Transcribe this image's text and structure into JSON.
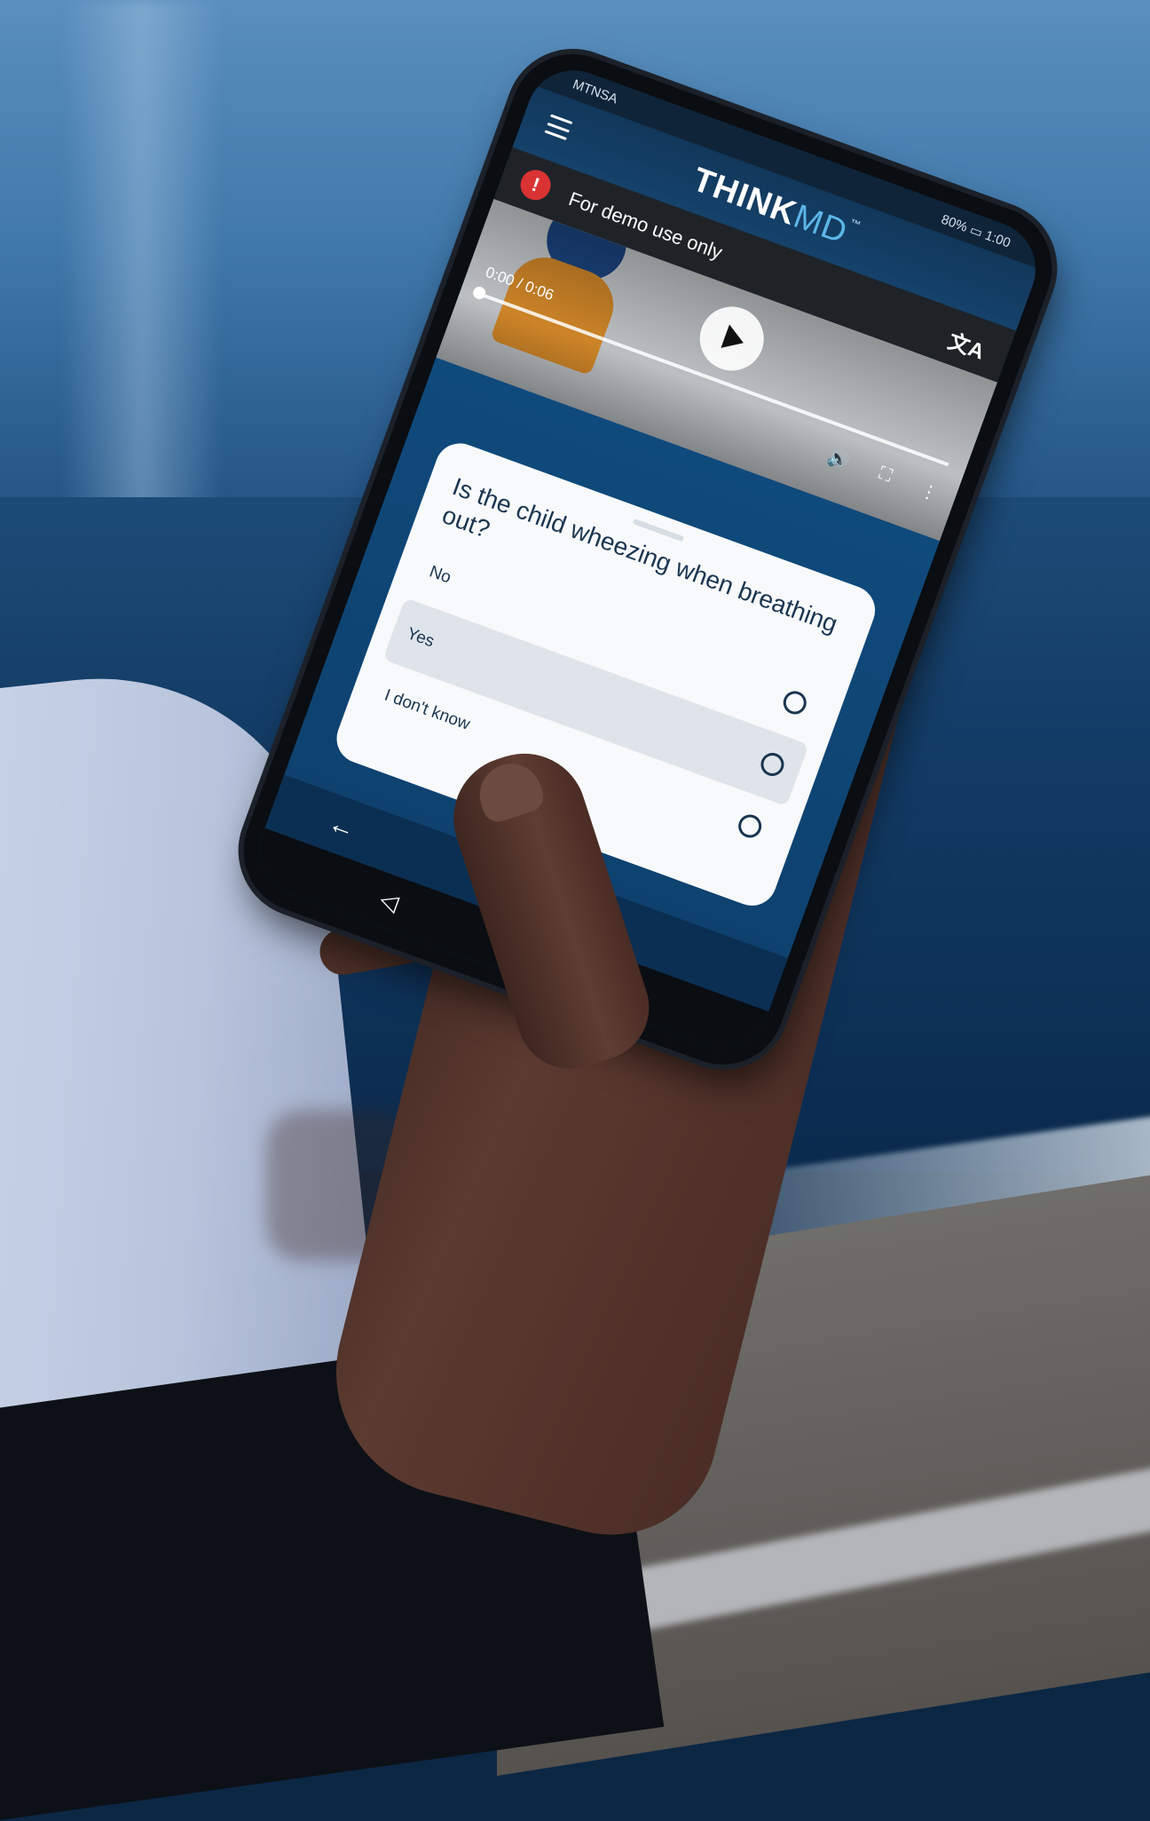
{
  "status_bar": {
    "carrier": "MTNSA",
    "battery": "80%",
    "time": "1:00"
  },
  "app_bar": {
    "logo_think": "THINK",
    "logo_md": "MD",
    "logo_tm": "™"
  },
  "banner": {
    "text": "For demo use only",
    "alert_glyph": "!"
  },
  "video": {
    "time": "0:00 / 0:06",
    "progress": 0.0
  },
  "question": {
    "text": "Is the child wheezing when breathing out?",
    "options": [
      {
        "label": "No",
        "selected": false
      },
      {
        "label": "Yes",
        "selected": true
      },
      {
        "label": "I don't know",
        "selected": false
      }
    ]
  },
  "icons": {
    "menu": "menu-icon",
    "alert": "alert-icon",
    "translate": "translate-icon",
    "play": "play-icon",
    "volume": "volume-icon",
    "fullscreen": "fullscreen-icon",
    "more": "more-vertical-icon",
    "back": "back-arrow-icon"
  },
  "colors": {
    "app_bar": "#15426b",
    "banner": "#1f2328",
    "alert": "#d93333",
    "card": "#f7f9fb",
    "selected_option": "#dfe4ea",
    "text_primary": "#1b3550",
    "logo_md": "#5cb6e8"
  }
}
